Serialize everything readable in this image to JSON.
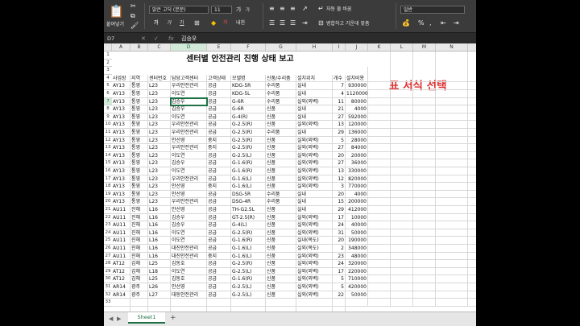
{
  "ribbon": {
    "paste_label": "붙여넣기",
    "font_name": "맑은 고딕 (본문)",
    "font_size": "11",
    "font_grow": "가",
    "font_shrink": "가",
    "bold": "가",
    "italic": "가",
    "underline": "가",
    "phonetic": "내천",
    "wrap_text": "자동 줄 바꿈",
    "merge_center": "병합하고 가운데 맞춤",
    "number_format": "일반",
    "percent": "%",
    "comma": ","
  },
  "formula_bar": {
    "name_box": "D7",
    "cancel": "✕",
    "enter": "✓",
    "fx": "fx",
    "value": "김승우"
  },
  "sheet": {
    "title": "센터별 안전관리 진행 상태 보고",
    "note": "표 서식 선택",
    "columns": [
      "A",
      "B",
      "C",
      "D",
      "E",
      "F",
      "G",
      "H",
      "I",
      "J",
      "K",
      "L",
      "M",
      "N"
    ],
    "rows_numbers": [
      "1",
      "2",
      "3",
      "4",
      "5",
      "6",
      "7",
      "8",
      "9",
      "10",
      "11",
      "12",
      "13",
      "14",
      "15",
      "16",
      "17",
      "18",
      "19",
      "20",
      "21",
      "22",
      "23",
      "24",
      "25",
      "26",
      "27",
      "28",
      "29",
      "30",
      "31",
      "32",
      "33"
    ],
    "headers": [
      "사업장",
      "지역",
      "센터번호",
      "담당고객센터",
      "고객상태",
      "모델명",
      "신품/수리품",
      "설치위치",
      "개수",
      "설치비용"
    ],
    "data": [
      [
        "AY13",
        "통영",
        "L23",
        "우리안전관리",
        "공급",
        "KDG-5R",
        "수리품",
        "실내",
        "7",
        "930000"
      ],
      [
        "AY13",
        "통영",
        "L23",
        "이도연",
        "공급",
        "KDG-5L",
        "수리품",
        "실내",
        "4",
        "1120000"
      ],
      [
        "AY13",
        "통영",
        "L23",
        "김승우",
        "공급",
        "G-6R",
        "수리품",
        "실외(외벽)",
        "11",
        "80000"
      ],
      [
        "AY13",
        "통영",
        "L23",
        "김승우",
        "공급",
        "G-6R",
        "신품",
        "실내",
        "21",
        "4000"
      ],
      [
        "AY13",
        "통영",
        "L23",
        "이도연",
        "공급",
        "G-4(R)",
        "신품",
        "실내",
        "27",
        "592000"
      ],
      [
        "AY13",
        "통영",
        "L23",
        "우리안전관리",
        "공급",
        "G-2.5(R)",
        "신품",
        "실외(외벽)",
        "13",
        "120000"
      ],
      [
        "AY13",
        "통영",
        "L23",
        "우리안전관리",
        "공급",
        "G-2.5(R)",
        "수리품",
        "실내",
        "29",
        "136000"
      ],
      [
        "AY13",
        "통영",
        "L23",
        "안선영",
        "중지",
        "G-2.5(R)",
        "신품",
        "실외(외벽)",
        "5",
        "28000"
      ],
      [
        "AY13",
        "통영",
        "L23",
        "우리안전관리",
        "중지",
        "G-2.5(R)",
        "신품",
        "실외(외벽)",
        "27",
        "84000"
      ],
      [
        "AY13",
        "통영",
        "L23",
        "이도연",
        "공급",
        "G-2.5(L)",
        "신품",
        "실외(외벽)",
        "20",
        "20000"
      ],
      [
        "AY13",
        "통영",
        "L23",
        "김승우",
        "공급",
        "G-1.6(R)",
        "신품",
        "실외(외벽)",
        "27",
        "36000"
      ],
      [
        "AY13",
        "통영",
        "L23",
        "이도연",
        "공급",
        "G-1.6(R)",
        "신품",
        "실외(외벽)",
        "13",
        "330000"
      ],
      [
        "AY13",
        "통영",
        "L23",
        "우리안전관리",
        "공급",
        "G-1.6(L)",
        "신품",
        "실외(외벽)",
        "12",
        "820000"
      ],
      [
        "AY13",
        "통영",
        "L23",
        "안선영",
        "중지",
        "G-1.6(L)",
        "신품",
        "실외(외벽)",
        "3",
        "770000"
      ],
      [
        "AY13",
        "통영",
        "L23",
        "안선영",
        "공급",
        "DSG-5R",
        "수리품",
        "실내",
        "20",
        "4000"
      ],
      [
        "AY13",
        "통영",
        "L23",
        "우리안전관리",
        "공급",
        "DSG-4R",
        "수리품",
        "실내",
        "15",
        "200000"
      ],
      [
        "AU11",
        "진해",
        "L16",
        "안선영",
        "공급",
        "TH-G2.5L",
        "신품",
        "실내",
        "29",
        "412000"
      ],
      [
        "AU11",
        "진해",
        "L16",
        "김승우",
        "공급",
        "GT-2.5(R)",
        "신품",
        "실외(외벽)",
        "17",
        "10000"
      ],
      [
        "AU11",
        "진해",
        "L16",
        "김승우",
        "공급",
        "G-4(L)",
        "신품",
        "실외(외벽)",
        "24",
        "40000"
      ],
      [
        "AU11",
        "진해",
        "L16",
        "이도연",
        "공급",
        "G-2.5(R)",
        "신품",
        "실외(외벽)",
        "31",
        "50000"
      ],
      [
        "AU11",
        "진해",
        "L16",
        "이도연",
        "공급",
        "G-1.6(R)",
        "신품",
        "실내(복도)",
        "20",
        "190000"
      ],
      [
        "AU11",
        "진해",
        "L16",
        "대진안전관리",
        "공급",
        "G-1.6(L)",
        "신품",
        "실외(복도)",
        "2",
        "348000"
      ],
      [
        "AU11",
        "진해",
        "L16",
        "대진안전관리",
        "중지",
        "G-1.6(L)",
        "신품",
        "실외(외벽)",
        "23",
        "48000"
      ],
      [
        "AT12",
        "김해",
        "L25",
        "김동호",
        "공급",
        "G-2.5(R)",
        "신품",
        "실외(외벽)",
        "24",
        "320000"
      ],
      [
        "AT12",
        "김해",
        "L18",
        "이도연",
        "공급",
        "G-2.5(L)",
        "신품",
        "실외(외벽)",
        "17",
        "220000"
      ],
      [
        "AT12",
        "김해",
        "L25",
        "김동호",
        "공급",
        "G-1.6(R)",
        "신품",
        "실외(외벽)",
        "5",
        "710000"
      ],
      [
        "AR14",
        "광주",
        "L26",
        "안선영",
        "공급",
        "G-2.5(L)",
        "신품",
        "실외(외벽)",
        "5",
        "420000"
      ],
      [
        "AR14",
        "광주",
        "L27",
        "대동안전관리",
        "공급",
        "G-2.5(L)",
        "신품",
        "실외(외벽)",
        "22",
        "50000"
      ]
    ]
  },
  "tabs": {
    "sheet1": "Sheet1",
    "add": "+",
    "prev": "◀",
    "next": "▶"
  },
  "colors": {
    "accent_green": "#1e7145",
    "note_red": "#e03030",
    "ribbon_bg": "#3b3b3b"
  }
}
